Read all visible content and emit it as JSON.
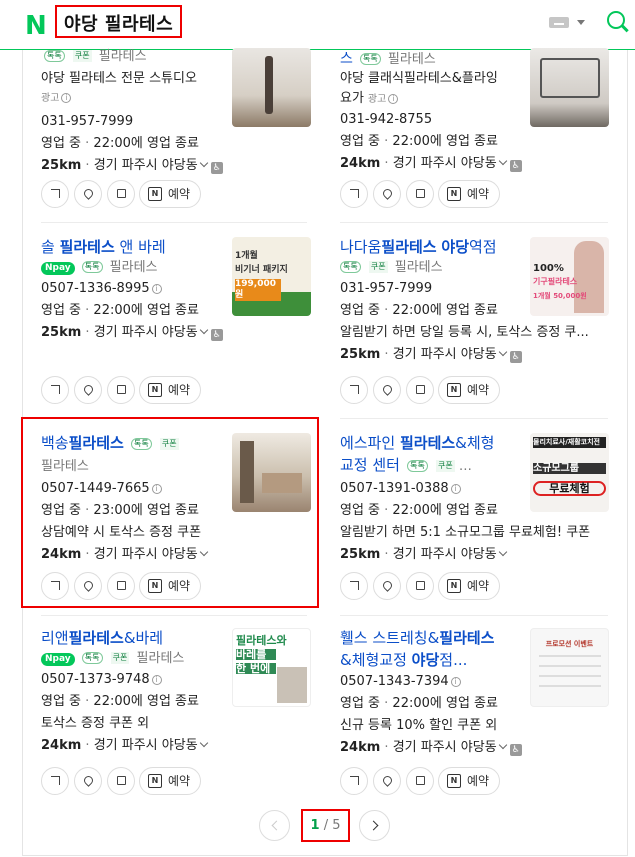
{
  "header": {
    "logo": "N",
    "query": "야당 필라테스"
  },
  "cards": [
    {
      "id": "c1",
      "name": "",
      "category": "필라테스",
      "talk": "톡톡",
      "coupon": "쿠폰",
      "line1": "야당 필라테스 전문 스튜디오",
      "ad": "광고",
      "phone": "031-957-7999",
      "status": "영업 중",
      "hours": "22:00에 영업 종료",
      "distance": "25km",
      "address": "경기 파주시 야당동"
    },
    {
      "id": "c2",
      "name": "스",
      "category": "필라테스",
      "talk": "톡톡",
      "coupon": "",
      "line1": "야당 클래식필라테스&플라잉",
      "line1b": "요가",
      "ad": "광고",
      "phone": "031-942-8755",
      "status": "영업 중",
      "hours": "22:00에 영업 종료",
      "distance": "24km",
      "address": "경기 파주시 야당동"
    },
    {
      "id": "c3",
      "name": "솔 필라테스 앤 바레",
      "category": "필라테스",
      "npay": "pay",
      "talk": "톡톡",
      "phone": "0507-1336-8995",
      "status": "영업 중",
      "hours": "22:00에 영업 종료",
      "distance": "25km",
      "address": "경기 파주시 야당동",
      "thumb_text": [
        "1개월",
        "비기너 패키지",
        "199,000원"
      ]
    },
    {
      "id": "c4",
      "name": "나다움필라테스 야당역점",
      "category": "필라테스",
      "talk": "톡톡",
      "coupon": "쿠폰",
      "phone": "031-957-7999",
      "status": "영업 중",
      "hours": "22:00에 영업 종료",
      "promo": "알림받기 하면 당일 등록 시, 토삭스 증정 쿠...",
      "distance": "25km",
      "address": "경기 파주시 야당동",
      "thumb_text": [
        "100%",
        "기구필라테스",
        "1개월 50,000원"
      ]
    },
    {
      "id": "c5",
      "name": "백송필라테스",
      "category": "필라테스",
      "talk": "톡톡",
      "coupon": "쿠폰",
      "phone": "0507-1449-7665",
      "status": "영업 중",
      "hours": "23:00에 영업 종료",
      "promo": "상담예약 시 토삭스 증정 쿠폰",
      "distance": "24km",
      "address": "경기 파주시 야당동"
    },
    {
      "id": "c6",
      "name": "에스파인 필라테스&체형",
      "name2": "교정 센터",
      "talk": "톡톡",
      "coupon": "쿠폰",
      "phone": "0507-1391-0388",
      "status": "영업 중",
      "hours": "22:00에 영업 종료",
      "promo": "알림받기 하면 5:1 소규모그룹 무료체험! 쿠폰",
      "distance": "25km",
      "address": "경기 파주시 야당동",
      "thumb_text": [
        "물리치료사/재활코치전",
        "소규모그룹",
        "무료체험"
      ]
    },
    {
      "id": "c7",
      "name": "리앤필라테스&바레",
      "category": "필라테스",
      "npay": "pay",
      "talk": "톡톡",
      "coupon": "쿠폰",
      "phone": "0507-1373-9748",
      "status": "영업 중",
      "hours": "22:00에 영업 종료",
      "promo": "토삭스 증정 쿠폰 외",
      "distance": "24km",
      "address": "경기 파주시 야당동",
      "thumb_text": [
        "필라테스와",
        "바레를",
        "한 번에"
      ]
    },
    {
      "id": "c8",
      "name": "휄스 스트레칭&필라테스",
      "name2": "&체형교정 야당점...",
      "phone": "0507-1343-7394",
      "status": "영업 중",
      "hours": "22:00에 영업 종료",
      "promo": "신규 등록 10% 할인 쿠폰 외",
      "distance": "24km",
      "address": "경기 파주시 야당동",
      "thumb_text": [
        "프로모션 이벤트"
      ]
    }
  ],
  "actions": {
    "reserve": "예약"
  },
  "pagination": {
    "current": "1",
    "total": "5",
    "sep": "/"
  }
}
